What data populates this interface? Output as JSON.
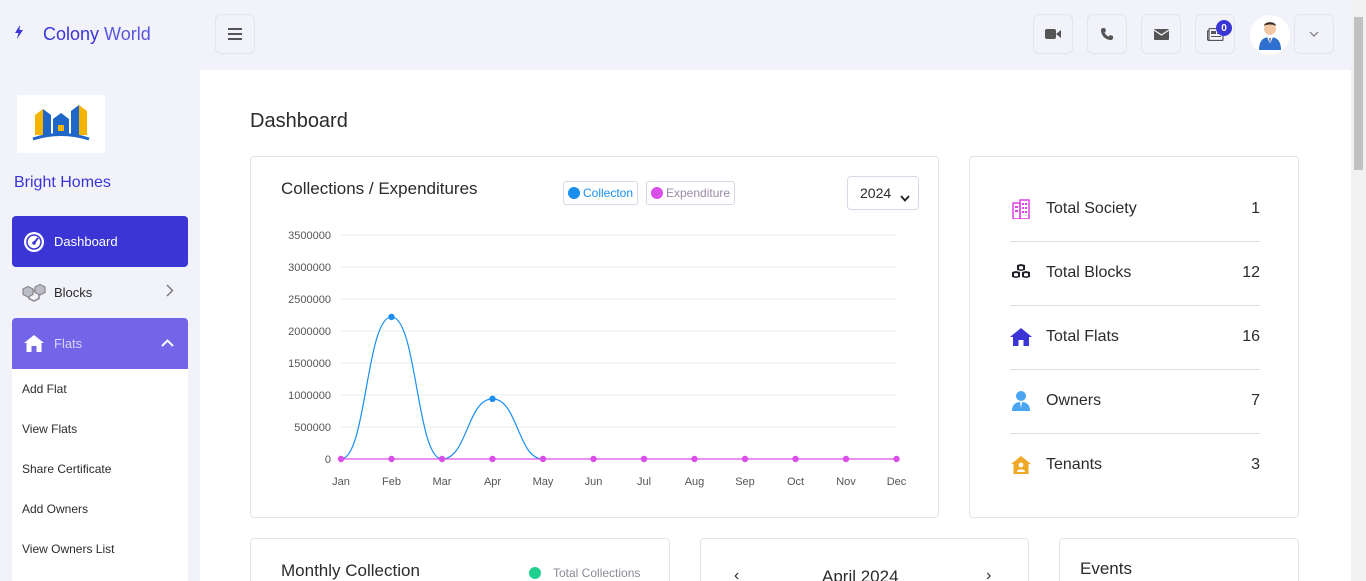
{
  "header": {
    "brand_first": "Colony",
    "brand_second": "World",
    "notification_count": "0"
  },
  "sidebar": {
    "org_name": "Bright Homes",
    "items": [
      {
        "label": "Dashboard"
      },
      {
        "label": "Blocks"
      },
      {
        "label": "Flats"
      }
    ],
    "flats_submenu": [
      "Add Flat",
      "View Flats",
      "Share Certificate",
      "Add Owners",
      "View Owners List"
    ]
  },
  "main": {
    "page_title": "Dashboard",
    "chart_card": {
      "title": "Collections / Expenditures",
      "legend": [
        {
          "label": "Collecton",
          "color": "#1a8ff0"
        },
        {
          "label": "Expenditure",
          "color": "#d94fe8"
        }
      ],
      "year_selected": "2024"
    },
    "stats": [
      {
        "label": "Total Society",
        "value": "1",
        "icon": "building-icon",
        "color": "#e040e8"
      },
      {
        "label": "Total Blocks",
        "value": "12",
        "icon": "cubes-icon",
        "color": "#1f1f2a"
      },
      {
        "label": "Total Flats",
        "value": "16",
        "icon": "home-icon",
        "color": "#3b35d6"
      },
      {
        "label": "Owners",
        "value": "7",
        "icon": "user-tie-icon",
        "color": "#4aa6f0"
      },
      {
        "label": "Tenants",
        "value": "3",
        "icon": "house-user-icon",
        "color": "#f0a829"
      }
    ],
    "monthly_collection": {
      "title": "Monthly Collection",
      "legend": "Total Collections"
    },
    "calendar": {
      "month": "April 2024",
      "prev": "‹",
      "next": "›"
    },
    "events": {
      "title": "Events"
    }
  },
  "chart_data": {
    "type": "line",
    "title": "Collections / Expenditures",
    "categories": [
      "Jan",
      "Feb",
      "Mar",
      "Apr",
      "May",
      "Jun",
      "Jul",
      "Aug",
      "Sep",
      "Oct",
      "Nov",
      "Dec"
    ],
    "series": [
      {
        "name": "Collecton",
        "color": "#1a8ff0",
        "values": [
          0,
          2220000,
          0,
          940000,
          0,
          null,
          null,
          null,
          null,
          null,
          null,
          null
        ]
      },
      {
        "name": "Expenditure",
        "color": "#d94fe8",
        "values": [
          0,
          0,
          0,
          0,
          0,
          0,
          0,
          0,
          0,
          0,
          0,
          0
        ]
      }
    ],
    "yticks": [
      0,
      500000,
      1000000,
      1500000,
      2000000,
      2500000,
      3000000,
      3500000
    ],
    "ylim": [
      0,
      3500000
    ],
    "grid": true
  }
}
